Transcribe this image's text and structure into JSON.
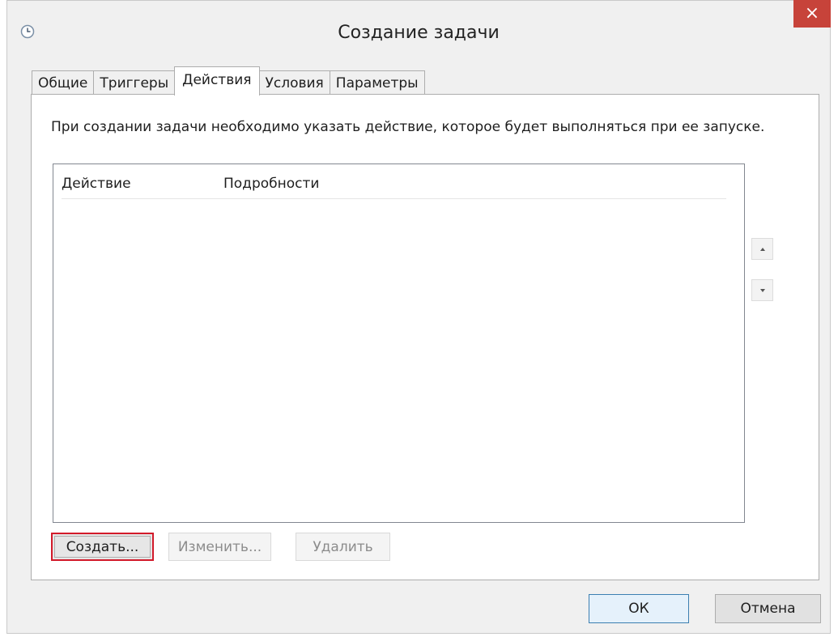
{
  "window": {
    "title": "Создание задачи",
    "close_glyph": "×"
  },
  "tabs": [
    {
      "label": "Общие",
      "active": false
    },
    {
      "label": "Триггеры",
      "active": false
    },
    {
      "label": "Действия",
      "active": true
    },
    {
      "label": "Условия",
      "active": false
    },
    {
      "label": "Параметры",
      "active": false
    }
  ],
  "actions_panel": {
    "description": "При создании задачи необходимо указать действие, которое будет выполняться при ее запуске.",
    "columns": {
      "action": "Действие",
      "details": "Подробности"
    },
    "rows": [],
    "move_up_icon": "triangle-up-icon",
    "move_down_icon": "triangle-down-icon",
    "create_button": "Создать...",
    "edit_button": "Изменить...",
    "delete_button": "Удалить"
  },
  "footer": {
    "ok_button": "ОК",
    "cancel_button": "Отмена"
  },
  "colors": {
    "close_button": "#c7433a",
    "highlight_border": "#d21a2a",
    "disabled_text": "#8c8c8c"
  }
}
